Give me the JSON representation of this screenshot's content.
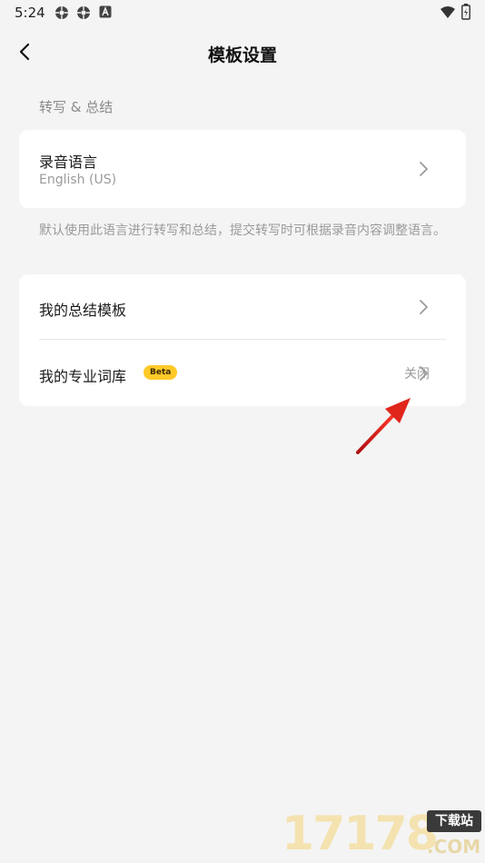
{
  "status_bar": {
    "time": "5:24",
    "icons": [
      "settings-cog-icon",
      "settings-cog-icon",
      "a-letter-icon"
    ],
    "right_icons": [
      "wifi-icon",
      "battery-icon"
    ]
  },
  "header": {
    "title": "模板设置",
    "back_icon": "chevron-left-icon"
  },
  "section": {
    "label": "转写 & 总结"
  },
  "recording_language": {
    "title": "录音语言",
    "value": "English (US)"
  },
  "note": "默认使用此语言进行转写和总结，提交转写时可根据录音内容调整语言。",
  "templates": {
    "summary_template": "我的总结模板",
    "vocabulary": "我的专业词库",
    "vocabulary_badge": "Beta",
    "vocabulary_value": "关闭"
  },
  "watermark": {
    "digits": "17178",
    "box": "下载站",
    "domain": ".COM"
  },
  "colors": {
    "background": "#f4f4f4",
    "card": "#ffffff",
    "badge": "#ffc928",
    "arrow": "#e0251b"
  }
}
